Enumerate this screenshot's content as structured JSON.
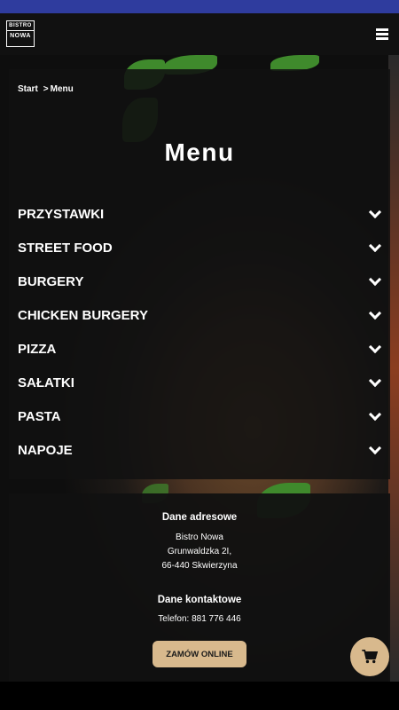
{
  "header": {
    "logo_line1": "BISTRO",
    "logo_line2": "NOWA",
    "menu_icon": "hamburger-icon"
  },
  "breadcrumb": {
    "home": "Start",
    "separator": ">",
    "current": "Menu"
  },
  "page": {
    "title": "Menu"
  },
  "menu": {
    "expand_icon": "chevron-down-icon",
    "items": [
      {
        "label": "PRZYSTAWKI"
      },
      {
        "label": "STREET FOOD"
      },
      {
        "label": "BURGERY"
      },
      {
        "label": "CHICKEN BURGERY"
      },
      {
        "label": "PIZZA"
      },
      {
        "label": "SAŁATKI"
      },
      {
        "label": "PASTA"
      },
      {
        "label": "NAPOJE"
      }
    ]
  },
  "footer": {
    "address_heading": "Dane adresowe",
    "address_name": "Bistro Nowa",
    "address_street": "Grunwaldzka 2I,",
    "address_city": "66-440 Skwierzyna",
    "contact_heading": "Dane kontaktowe",
    "phone": "Telefon: 881 776 446",
    "order_button": "ZAMÓW ONLINE"
  },
  "cart": {
    "icon": "cart-icon"
  },
  "colors": {
    "top_bar": "#2f3c9e",
    "accent": "#d8b98d",
    "panel": "#111111"
  }
}
